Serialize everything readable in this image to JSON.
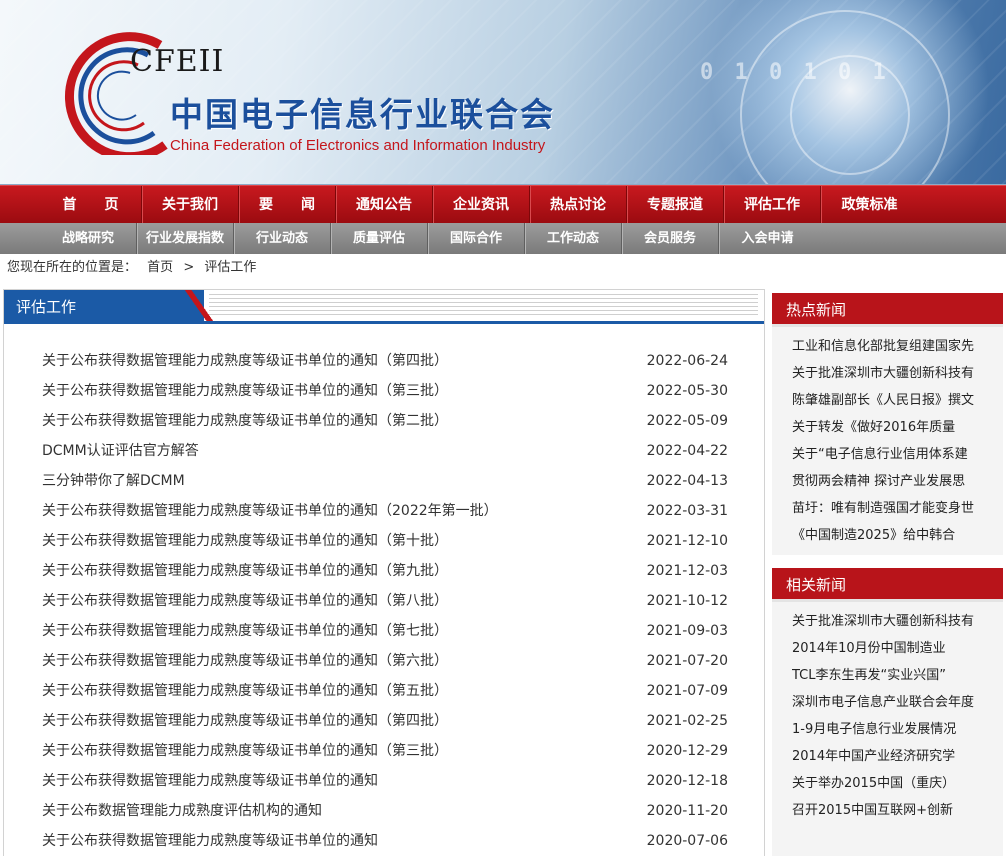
{
  "brand": {
    "abbr": "CFEII",
    "name_cn": "中国电子信息行业联合会",
    "name_en": "China Federation of Electronics and Information Industry",
    "banner_digits": "0 1 0 1 0 1",
    "colors": {
      "red": "#c8191f",
      "blue": "#1b5aa6",
      "gray": "#8a8a8a"
    }
  },
  "nav_main": [
    "首　　页",
    "关于我们",
    "要　　闻",
    "通知公告",
    "企业资讯",
    "热点讨论",
    "专题报道",
    "评估工作",
    "政策标准"
  ],
  "nav_sub": [
    "战略研究",
    "行业发展指数",
    "行业动态",
    "质量评估",
    "国际合作",
    "工作动态",
    "会员服务",
    "入会申请"
  ],
  "breadcrumb": {
    "prefix": "您现在所在的位置是：",
    "home": "首页",
    "sep": ">",
    "current": "评估工作"
  },
  "section": {
    "title": "评估工作"
  },
  "articles": [
    {
      "title": "关于公布获得数据管理能力成熟度等级证书单位的通知（第四批）",
      "date": "2022-06-24"
    },
    {
      "title": "关于公布获得数据管理能力成熟度等级证书单位的通知（第三批）",
      "date": "2022-05-30"
    },
    {
      "title": "关于公布获得数据管理能力成熟度等级证书单位的通知（第二批）",
      "date": "2022-05-09"
    },
    {
      "title": "DCMM认证评估官方解答",
      "date": "2022-04-22"
    },
    {
      "title": "三分钟带你了解DCMM",
      "date": "2022-04-13"
    },
    {
      "title": "关于公布获得数据管理能力成熟度等级证书单位的通知（2022年第一批）",
      "date": "2022-03-31"
    },
    {
      "title": "关于公布获得数据管理能力成熟度等级证书单位的通知（第十批）",
      "date": "2021-12-10"
    },
    {
      "title": "关于公布获得数据管理能力成熟度等级证书单位的通知（第九批）",
      "date": "2021-12-03"
    },
    {
      "title": "关于公布获得数据管理能力成熟度等级证书单位的通知（第八批）",
      "date": "2021-10-12"
    },
    {
      "title": "关于公布获得数据管理能力成熟度等级证书单位的通知（第七批）",
      "date": "2021-09-03"
    },
    {
      "title": "关于公布获得数据管理能力成熟度等级证书单位的通知（第六批）",
      "date": "2021-07-20"
    },
    {
      "title": "关于公布获得数据管理能力成熟度等级证书单位的通知（第五批）",
      "date": "2021-07-09"
    },
    {
      "title": "关于公布获得数据管理能力成熟度等级证书单位的通知（第四批）",
      "date": "2021-02-25"
    },
    {
      "title": "关于公布获得数据管理能力成熟度等级证书单位的通知（第三批）",
      "date": "2020-12-29"
    },
    {
      "title": "关于公布获得数据管理能力成熟度等级证书单位的通知",
      "date": "2020-12-18"
    },
    {
      "title": "关于公布数据管理能力成熟度评估机构的通知",
      "date": "2020-11-20"
    },
    {
      "title": "关于公布获得数据管理能力成熟度等级证书单位的通知",
      "date": "2020-07-06"
    }
  ],
  "hot_news": {
    "title": "热点新闻",
    "items": [
      "工业和信息化部批复组建国家先",
      "关于批准深圳市大疆创新科技有",
      "陈肇雄副部长《人民日报》撰文",
      "关于转发《做好2016年质量",
      "关于“电子信息行业信用体系建",
      "贯彻两会精神 探讨产业发展思",
      "苗圩：唯有制造强国才能变身世",
      "《中国制造2025》给中韩合"
    ]
  },
  "related_news": {
    "title": "相关新闻",
    "items": [
      "关于批准深圳市大疆创新科技有",
      "2014年10月份中国制造业",
      "TCL李东生再发“实业兴国”",
      "深圳市电子信息产业联合会年度",
      "1-9月电子信息行业发展情况",
      "2014年中国产业经济研究学",
      "关于举办2015中国（重庆）",
      "召开2015中国互联网+创新"
    ]
  }
}
